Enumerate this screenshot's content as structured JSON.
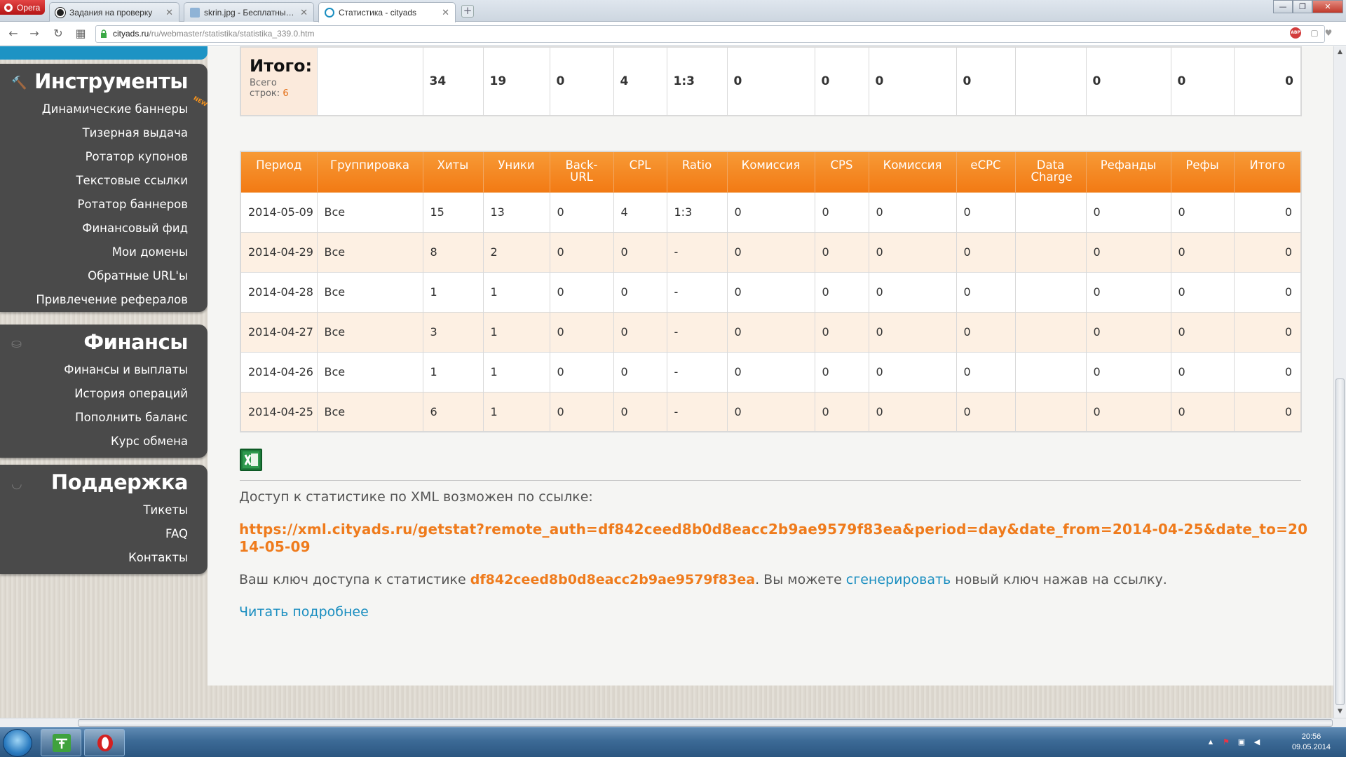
{
  "browser": {
    "menu_label": "Opera",
    "tabs": [
      {
        "title": "Задания на проверку",
        "close": "✕"
      },
      {
        "title": "skrin.jpg - Бесплатный хо",
        "close": "✕"
      },
      {
        "title": "Статистика - cityads",
        "close": "✕"
      }
    ],
    "new_tab": "+",
    "window_controls": {
      "minimize": "—",
      "maximize": "❐",
      "close": "✕"
    },
    "nav": {
      "back": "←",
      "forward": "→",
      "reload": "↻",
      "speed_dial": "▦"
    },
    "url_host": "cityads.ru",
    "url_path": "/ru/webmaster/statistika/statistika_339.0.htm",
    "abp_label": "ABP"
  },
  "sidebar": {
    "sections": [
      {
        "title": "Инструменты",
        "icon": "hammer-icon",
        "items": [
          {
            "label": "Динамические баннеры",
            "badge": "NEW"
          },
          {
            "label": "Тизерная выдача"
          },
          {
            "label": "Ротатор купонов"
          },
          {
            "label": "Текстовые ссылки"
          },
          {
            "label": "Ротатор баннеров"
          },
          {
            "label": "Финансовый фид"
          },
          {
            "label": "Мои домены"
          },
          {
            "label": "Обратные URL'ы"
          },
          {
            "label": "Привлечение рефералов"
          }
        ]
      },
      {
        "title": "Финансы",
        "icon": "coins-icon",
        "items": [
          {
            "label": "Финансы и выплаты"
          },
          {
            "label": "История операций"
          },
          {
            "label": "Пополнить баланс"
          },
          {
            "label": "Курс обмена"
          }
        ]
      },
      {
        "title": "Поддержка",
        "icon": "headset-icon",
        "items": [
          {
            "label": "Тикеты"
          },
          {
            "label": "FAQ"
          },
          {
            "label": "Контакты"
          }
        ]
      }
    ]
  },
  "totals": {
    "title": "Итого:",
    "rows_label_1": "Всего",
    "rows_label_2": "строк:",
    "rows_count": "6",
    "values": [
      "",
      "34",
      "19",
      "0",
      "4",
      "1:3",
      "0",
      "0",
      "0",
      "0",
      "",
      "0",
      "0",
      "0"
    ]
  },
  "stats_table": {
    "headers": [
      "Период",
      "Группировка",
      "Хиты",
      "Уники",
      "Back-URL",
      "CPL",
      "Ratio",
      "Комиссия",
      "CPS",
      "Комиссия",
      "eCPC",
      "Data Charge",
      "Рефанды",
      "Рефы",
      "Итого"
    ],
    "rows": [
      [
        "2014-05-09",
        "Все",
        "15",
        "13",
        "0",
        "4",
        "1:3",
        "0",
        "0",
        "0",
        "0",
        "",
        "0",
        "0",
        "0"
      ],
      [
        "2014-04-29",
        "Все",
        "8",
        "2",
        "0",
        "0",
        "-",
        "0",
        "0",
        "0",
        "0",
        "",
        "0",
        "0",
        "0"
      ],
      [
        "2014-04-28",
        "Все",
        "1",
        "1",
        "0",
        "0",
        "-",
        "0",
        "0",
        "0",
        "0",
        "",
        "0",
        "0",
        "0"
      ],
      [
        "2014-04-27",
        "Все",
        "3",
        "1",
        "0",
        "0",
        "-",
        "0",
        "0",
        "0",
        "0",
        "",
        "0",
        "0",
        "0"
      ],
      [
        "2014-04-26",
        "Все",
        "1",
        "1",
        "0",
        "0",
        "-",
        "0",
        "0",
        "0",
        "0",
        "",
        "0",
        "0",
        "0"
      ],
      [
        "2014-04-25",
        "Все",
        "6",
        "1",
        "0",
        "0",
        "-",
        "0",
        "0",
        "0",
        "0",
        "",
        "0",
        "0",
        "0"
      ]
    ]
  },
  "xml": {
    "note": "Доступ к статистике по XML возможен по ссылке:",
    "link": "https://xml.cityads.ru/getstat?remote_auth=df842ceed8b0d8eacc2b9ae9579f83ea&period=day&date_from=2014-04-25&date_to=2014-05-09",
    "key_prefix": "Ваш ключ доступа к статистике ",
    "key": "df842ceed8b0d8eacc2b9ae9579f83ea",
    "key_middle": ". Вы можете ",
    "generate_link": "сгенерировать",
    "key_suffix": " новый ключ нажав на ссылку.",
    "more_link": "Читать подробнее"
  },
  "taskbar": {
    "clock_time": "20:56",
    "clock_date": "09.05.2014"
  },
  "colors": {
    "accent_orange": "#f27a14",
    "link_blue": "#1a8ec0",
    "sidebar_bg": "#4a4a4a",
    "top_strip_blue": "#1d93c4"
  }
}
